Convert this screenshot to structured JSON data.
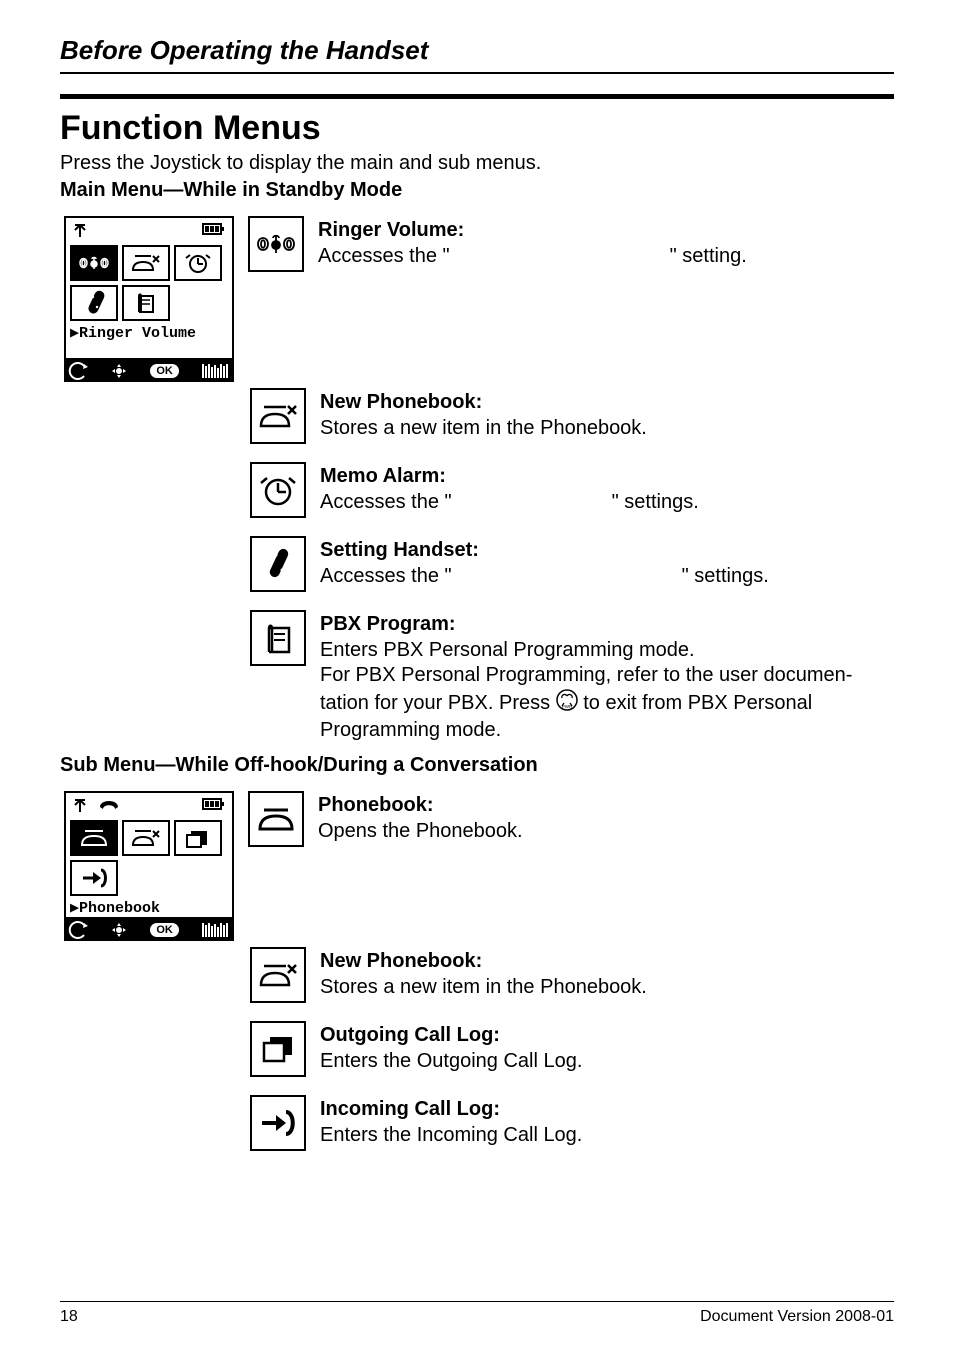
{
  "header": {
    "section": "Before Operating the Handset"
  },
  "title": "Function Menus",
  "intro": "Press the Joystick to display the main and sub menus.",
  "main_menu": {
    "heading": "Main Menu—While in Standby Mode",
    "screen_label": "▶Ringer Volume",
    "items": [
      {
        "icon": "ringer-volume-icon",
        "label": "Ringer Volume:",
        "desc_prefix": "Accesses the \"",
        "desc_mid": "",
        "desc_suffix": "\" setting."
      },
      {
        "icon": "new-phonebook-icon",
        "label": "New Phonebook:",
        "desc": "Stores a new item in the Phonebook."
      },
      {
        "icon": "memo-alarm-icon",
        "label": "Memo Alarm:",
        "desc_prefix": "Accesses the \"",
        "desc_mid": "",
        "desc_suffix": "\" settings."
      },
      {
        "icon": "setting-handset-icon",
        "label": "Setting Handset:",
        "desc_prefix": "Accesses the \"",
        "desc_mid": "",
        "desc_suffix": "\" settings."
      },
      {
        "icon": "pbx-program-icon",
        "label": "PBX Program:",
        "desc_line1": "Enters PBX Personal Programming mode.",
        "desc_line2": "For PBX Personal Programming, refer to the user documen-",
        "desc_line3a": "tation for your PBX. Press ",
        "desc_line3b": " to exit from PBX Personal",
        "desc_line4": "Programming mode."
      }
    ]
  },
  "sub_menu": {
    "heading": "Sub Menu—While Off-hook/During a Conversation",
    "screen_label": "▶Phonebook",
    "items": [
      {
        "icon": "phonebook-icon",
        "label": "Phonebook:",
        "desc": "Opens the Phonebook."
      },
      {
        "icon": "new-phonebook-icon",
        "label": "New Phonebook:",
        "desc": "Stores a new item in the Phonebook."
      },
      {
        "icon": "outgoing-call-log-icon",
        "label": "Outgoing Call Log:",
        "desc": "Enters the Outgoing Call Log."
      },
      {
        "icon": "incoming-call-log-icon",
        "label": "Incoming Call Log:",
        "desc": "Enters the Incoming Call Log."
      }
    ]
  },
  "footer": {
    "page": "18",
    "docver": "Document Version 2008-01"
  },
  "softkey_ok": "OK"
}
